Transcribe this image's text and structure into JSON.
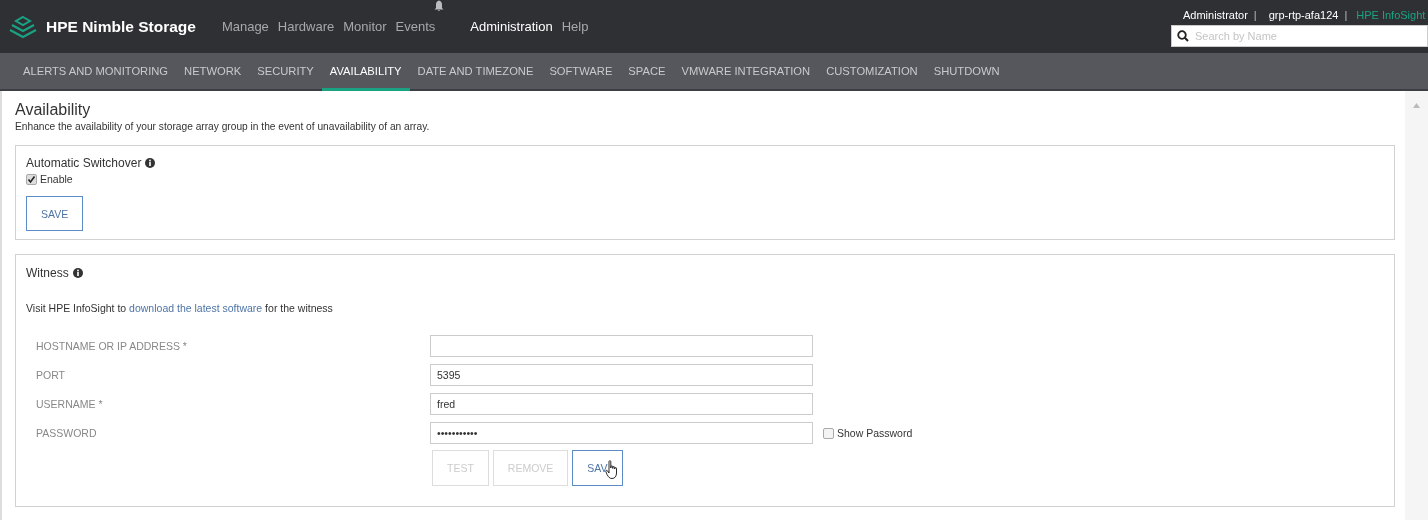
{
  "header": {
    "brand": "HPE Nimble Storage",
    "nav": [
      {
        "label": "Manage",
        "selected": false
      },
      {
        "label": "Hardware",
        "selected": false
      },
      {
        "label": "Monitor",
        "selected": false
      },
      {
        "label": "Events",
        "selected": false,
        "bell": true
      },
      {
        "label": "Administration",
        "selected": true
      },
      {
        "label": "Help",
        "selected": false
      }
    ],
    "user": "Administrator",
    "separator_1": "|",
    "group": "grp-rtp-afa124",
    "separator_2": "|",
    "infosight": "HPE InfoSight",
    "search": {
      "placeholder": "Search by Name"
    }
  },
  "tabs": [
    {
      "label": "ALERTS AND MONITORING",
      "selected": false
    },
    {
      "label": "NETWORK",
      "selected": false
    },
    {
      "label": "SECURITY",
      "selected": false
    },
    {
      "label": "AVAILABILITY",
      "selected": true
    },
    {
      "label": "DATE AND TIMEZONE",
      "selected": false
    },
    {
      "label": "SOFTWARE",
      "selected": false
    },
    {
      "label": "SPACE",
      "selected": false
    },
    {
      "label": "VMWARE INTEGRATION",
      "selected": false
    },
    {
      "label": "CUSTOMIZATION",
      "selected": false
    },
    {
      "label": "SHUTDOWN",
      "selected": false
    }
  ],
  "page": {
    "title": "Availability",
    "description": "Enhance the availability of your storage array group in the event of unavailability of an array."
  },
  "switchover": {
    "title": "Automatic Switchover",
    "enable": {
      "label": "Enable",
      "checked": true
    },
    "save": "SAVE"
  },
  "witness": {
    "title": "Witness",
    "intro_before": "Visit HPE InfoSight to",
    "link": "download the latest software",
    "intro_after": "for the witness",
    "fields": [
      {
        "label": "HOSTNAME OR IP ADDRESS *"
      },
      {
        "label": "PORT",
        "value": "5395"
      },
      {
        "label": "USERNAME *",
        "value": "fred"
      },
      {
        "label": "PASSWORD",
        "value": "•••••••••••",
        "show_password": {
          "label": "Show Password",
          "checked": false
        }
      }
    ],
    "buttons": [
      {
        "label": "TEST",
        "disabled": true,
        "focused": false
      },
      {
        "label": "REMOVE",
        "disabled": true,
        "focused": false
      },
      {
        "label": "SAV",
        "disabled": false,
        "focused": true,
        "cursor": true
      }
    ]
  }
}
